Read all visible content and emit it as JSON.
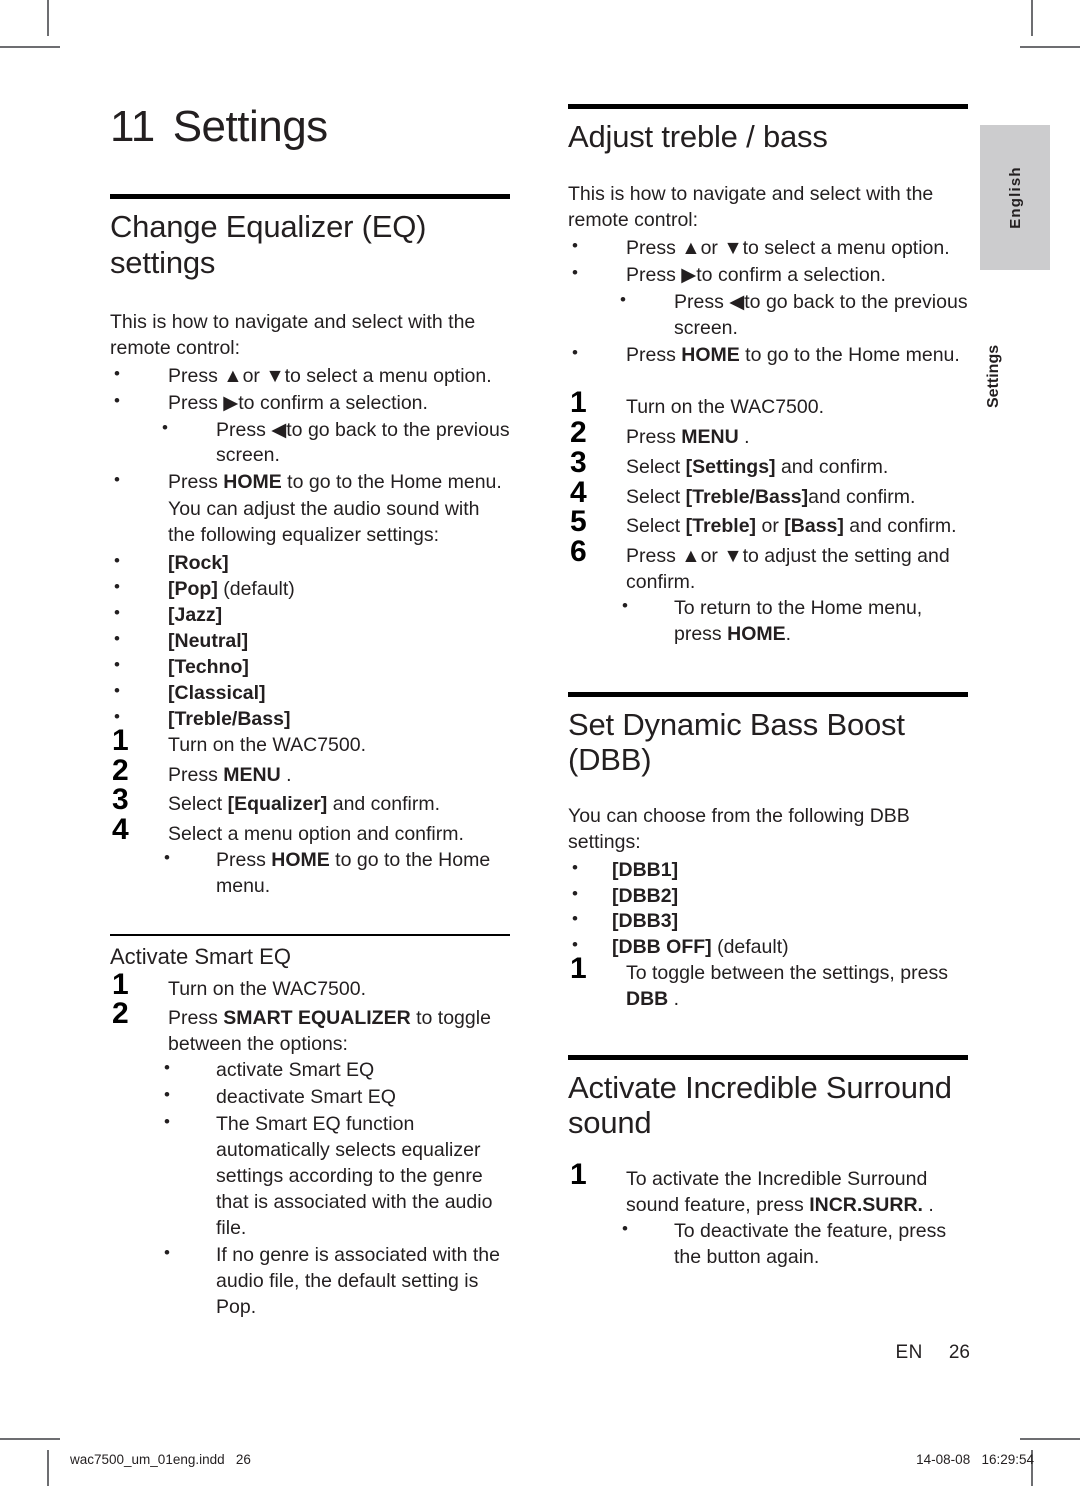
{
  "document": {
    "chapter_number": "11",
    "chapter_title": "Settings",
    "margin_tab": "English",
    "margin_section": "Settings",
    "folio_lang": "EN",
    "folio_page": "26",
    "footer_file": "wac7500_um_01eng.indd   26",
    "footer_stamp": "14-08-08   16:29:54"
  },
  "left_column": {
    "eq": {
      "heading": "Change Equalizer (EQ) settings",
      "intro": "This is how to navigate and select with the remote control:",
      "nav_bullets": [
        "Press ▲or ▼to select a menu option.",
        "Press ▶to confirm a selection."
      ],
      "nav_sub_bullet": "Press ◀to go back to the previous screen.",
      "nav_home_bullet_pre": "Press ",
      "nav_home_key": "HOME",
      "nav_home_bullet_post": " to go to the Home menu.",
      "adjust_intro": "You can adjust the audio sound with the following equalizer settings:",
      "presets": [
        {
          "name": "[Rock]",
          "note": ""
        },
        {
          "name": "[Pop]",
          "note": " (default)"
        },
        {
          "name": "[Jazz]",
          "note": ""
        },
        {
          "name": "[Neutral]",
          "note": ""
        },
        {
          "name": "[Techno]",
          "note": ""
        },
        {
          "name": "[Classical]",
          "note": ""
        },
        {
          "name": "[Treble/Bass]",
          "note": ""
        }
      ],
      "steps": [
        {
          "num": "1",
          "pre": "Turn on the WAC7500.",
          "kbd": "",
          "post": ""
        },
        {
          "num": "2",
          "pre": "Press ",
          "kbd": "MENU",
          "post": " ."
        },
        {
          "num": "3",
          "pre": "Select ",
          "kbd": "[Equalizer]",
          "post": " and confirm."
        },
        {
          "num": "4",
          "pre": "Select a menu option and confirm.",
          "kbd": "",
          "post": ""
        }
      ],
      "step4_sub_pre": "Press ",
      "step4_sub_key": "HOME",
      "step4_sub_post": " to go to the Home menu."
    },
    "smart_eq": {
      "heading": "Activate Smart EQ",
      "steps": [
        {
          "num": "1",
          "pre": "Turn on the WAC7500.",
          "kbd": "",
          "post": ""
        },
        {
          "num": "2",
          "pre": "Press ",
          "kbd": "SMART EQUALIZER",
          "post": " to toggle between the options:"
        }
      ],
      "sub_bullets": [
        "activate Smart EQ",
        "deactivate Smart EQ",
        "The Smart EQ function automatically selects equalizer settings according to the genre that is associated with the audio file.",
        "If no genre is associated with the audio file, the default setting is Pop."
      ]
    }
  },
  "right_column": {
    "treble_bass": {
      "heading": "Adjust treble / bass",
      "intro": "This is how to navigate and select with the remote control:",
      "nav_bullets": [
        "Press ▲or ▼to select a menu option.",
        "Press ▶to confirm a selection."
      ],
      "nav_sub_bullet": "Press ◀to go back to the previous screen.",
      "nav_home_bullet_pre": "Press ",
      "nav_home_key": "HOME",
      "nav_home_bullet_post": " to go to the Home menu.",
      "steps": [
        {
          "num": "1",
          "pre": "Turn on the WAC7500.",
          "kbd": "",
          "post": ""
        },
        {
          "num": "2",
          "pre": "Press ",
          "kbd": "MENU",
          "post": " ."
        },
        {
          "num": "3",
          "pre": "Select ",
          "kbd": "[Settings]",
          "post": " and confirm."
        },
        {
          "num": "4",
          "pre": "Select ",
          "kbd": "[Treble/Bass]",
          "post": "and confirm."
        },
        {
          "num": "5",
          "pre": "Select ",
          "kbd": "[Treble]",
          "post": " or ",
          "kbd2": "[Bass]",
          "post2": " and confirm."
        },
        {
          "num": "6",
          "pre": "Press ▲or ▼to adjust the setting and confirm.",
          "kbd": "",
          "post": ""
        }
      ],
      "step6_sub_pre": "To return to the Home menu, press ",
      "step6_sub_key": "HOME",
      "step6_sub_post": "."
    },
    "dbb": {
      "heading": "Set Dynamic Bass Boost (DBB)",
      "intro": "You can choose from the following DBB settings:",
      "options": [
        {
          "name": "[DBB1]",
          "note": ""
        },
        {
          "name": "[DBB2]",
          "note": ""
        },
        {
          "name": "[DBB3]",
          "note": ""
        },
        {
          "name": "[DBB OFF]",
          "note": " (default)"
        }
      ],
      "step": {
        "num": "1",
        "pre": "To toggle between the settings, press ",
        "kbd": "DBB",
        "post": " ."
      }
    },
    "surround": {
      "heading": "Activate Incredible Surround sound",
      "step": {
        "num": "1",
        "pre": "To activate the Incredible Surround sound feature, press ",
        "kbd": "INCR.SURR.",
        "post": " ."
      },
      "sub_bullet": "To deactivate the feature, press the button again."
    }
  }
}
